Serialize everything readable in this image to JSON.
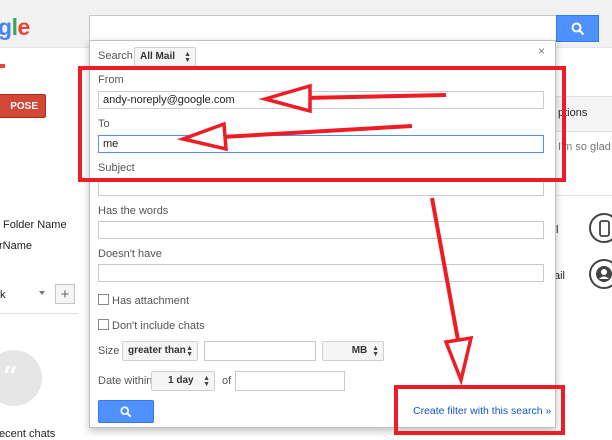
{
  "header": {
    "logo": {
      "g": "g",
      "l": "l",
      "e": "e"
    }
  },
  "sidebar": {
    "compose_label": "POSE",
    "items": [
      {
        "label": "Folder Name"
      },
      {
        "label": "rName"
      },
      {
        "label": "k"
      },
      {
        "label": "ecent chats"
      }
    ],
    "add_label": "+"
  },
  "right_panel": {
    "options_label": "ptions",
    "snippet": "I'm so glad y",
    "row1_label": "l",
    "row2_label": "ail"
  },
  "search_dialog": {
    "search_label": "Search",
    "scope_value": "All Mail",
    "close_label": "×",
    "from_label": "From",
    "from_value": "andy-noreply@google.com",
    "to_label": "To",
    "to_value": "me",
    "subject_label": "Subject",
    "subject_value": "",
    "has_words_label": "Has the words",
    "has_words_value": "",
    "doesnt_have_label": "Doesn't have",
    "doesnt_have_value": "",
    "has_attachment_label": "Has attachment",
    "has_attachment_checked": false,
    "dont_include_chats_label": "Don't include chats",
    "dont_include_chats_checked": false,
    "size_label": "Size",
    "size_operator": "greater than",
    "size_value": "",
    "size_unit": "MB",
    "date_within_label": "Date within",
    "date_within_value": "1 day",
    "of_label": "of",
    "date_value": "",
    "create_filter_label": "Create filter with this search »"
  },
  "icons": {
    "search": "search-icon",
    "hangouts": "hangouts-icon",
    "phone": "phone-icon",
    "account": "account-icon"
  },
  "colors": {
    "annotation": "#ee1c24",
    "button_blue": "#4d90fe",
    "compose_red": "#d14836",
    "link_blue": "#1155cc"
  }
}
